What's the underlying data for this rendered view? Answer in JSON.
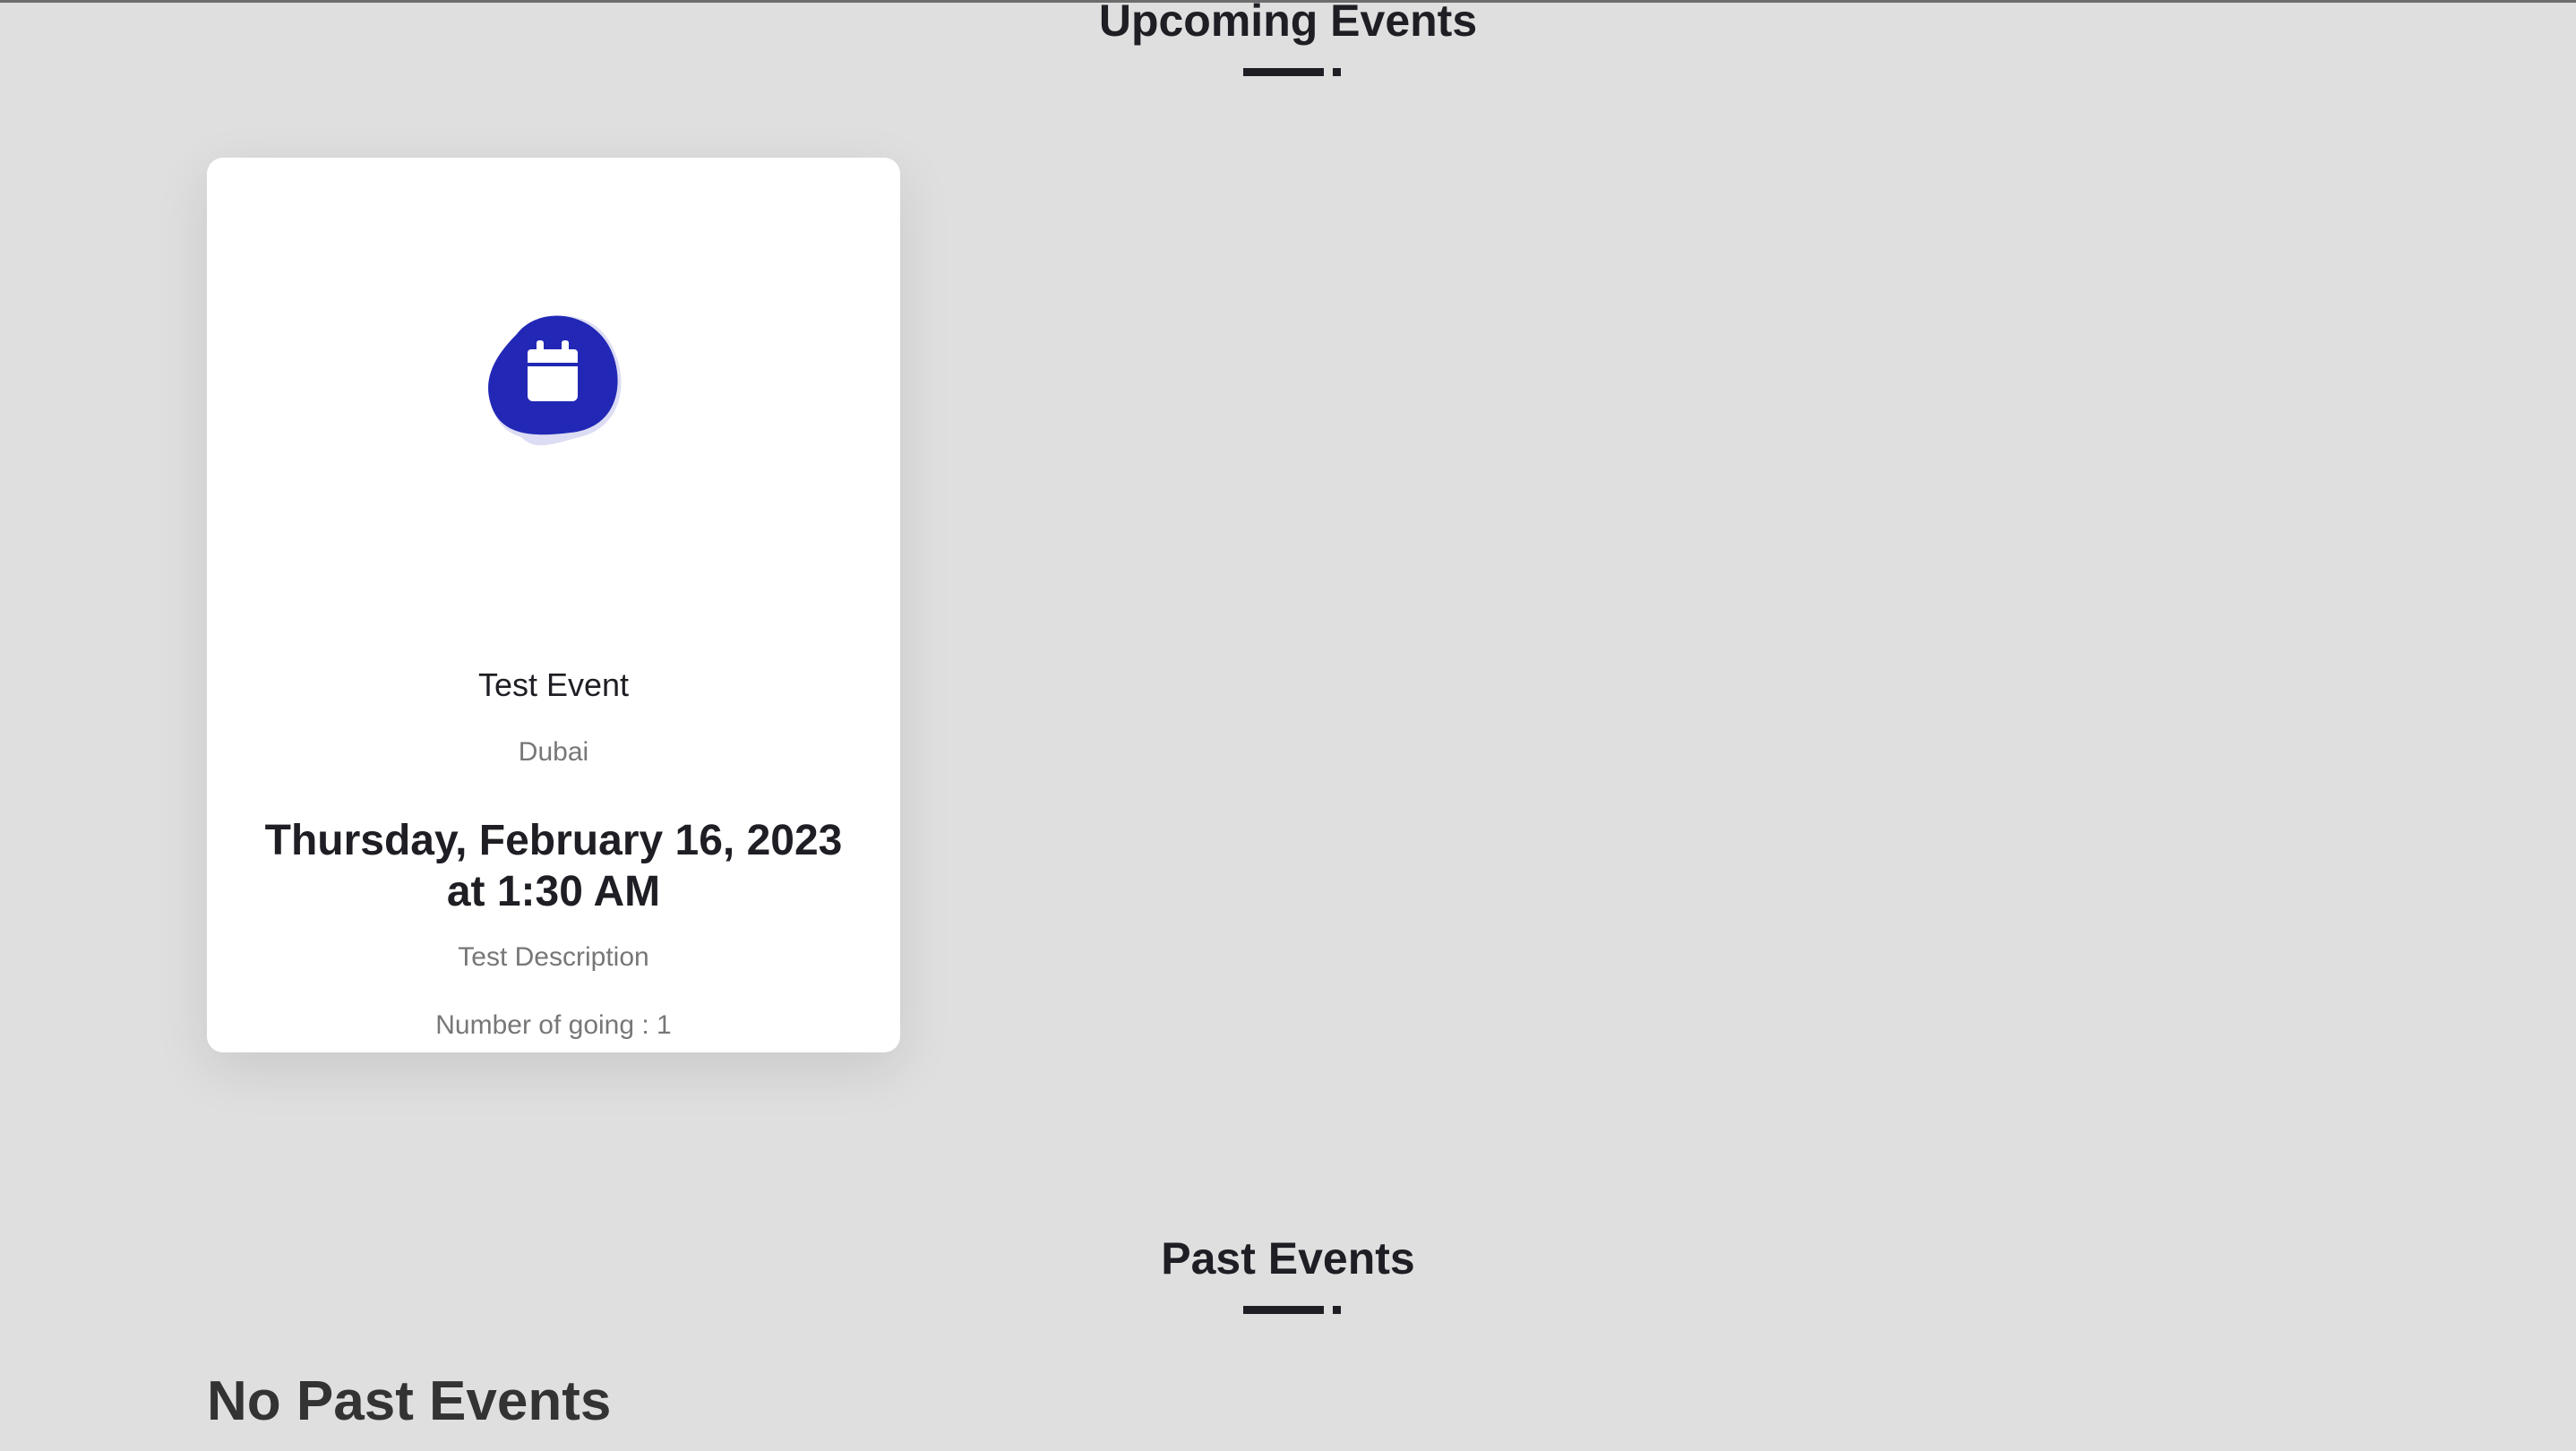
{
  "upcoming": {
    "title": "Upcoming Events"
  },
  "events": [
    {
      "title": "Test Event",
      "location": "Dubai",
      "datetime_line1": "Thursday, February 16, 2023",
      "datetime_line2": "at 1:30 AM",
      "description": "Test Description",
      "going": "Number of going : 1",
      "icon": "calendar-icon"
    }
  ],
  "past": {
    "title": "Past Events",
    "empty_message": "No Past Events"
  },
  "colors": {
    "background": "#dfdfdf",
    "card": "#ffffff",
    "accent": "#2228b5",
    "accent_soft": "#dcdcf4",
    "heading": "#1e1e24",
    "muted": "#777777"
  }
}
